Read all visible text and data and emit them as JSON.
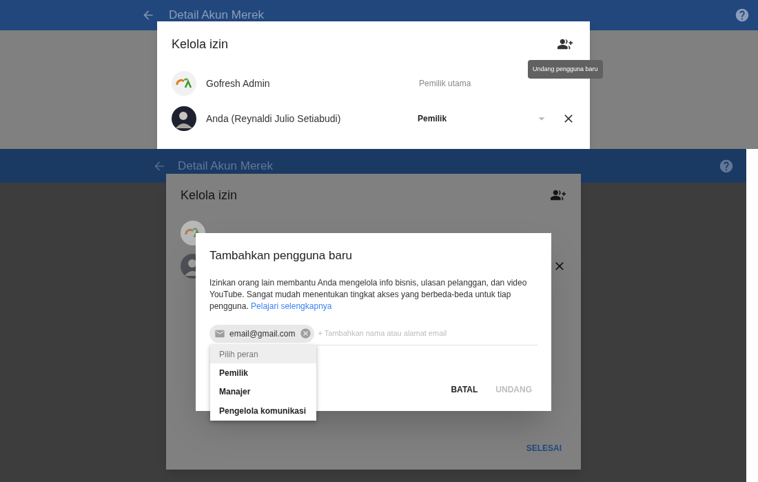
{
  "top_screen": {
    "app_bar": {
      "title": "Detail Akun Merek"
    },
    "dialog": {
      "title": "Kelola izin",
      "members": [
        {
          "kind": "fixed",
          "name": "Gofresh Admin",
          "role": "Pemilik utama"
        },
        {
          "kind": "editable",
          "name": "Anda (Reynaldi Julio Setiabudi)",
          "role": "Pemilik"
        }
      ]
    },
    "tooltip": "Undang pengguna baru"
  },
  "bottom_screen": {
    "app_bar": {
      "title": "Detail Akun Merek"
    },
    "dialog": {
      "title": "Kelola izin",
      "members": [
        {
          "kind": "fixed"
        },
        {
          "kind": "editable"
        }
      ],
      "done_button": "SELESAI"
    },
    "invite_dialog": {
      "title": "Tambahkan pengguna baru",
      "description": "Izinkan orang lain membantu Anda mengelola info bisnis, ulasan pelanggan, dan video YouTube. Sangat mudah menentukan tingkat akses yang berbeda-beda untuk tiap pengguna.",
      "link": "Pelajari selengkapnya",
      "chips": [
        {
          "text": "email@gmail.com"
        }
      ],
      "input": {
        "placeholder": "+ Tambahkan nama atau alamat email"
      },
      "role_menu": [
        {
          "label": "Pilih peran",
          "selected": true
        },
        {
          "label": "Pemilik",
          "selected": false
        },
        {
          "label": "Manajer",
          "selected": false
        },
        {
          "label": "Pengelola komunikasi",
          "selected": false
        }
      ],
      "buttons": [
        {
          "label": "BATAL",
          "disabled": false
        },
        {
          "label": "UNDANG",
          "disabled": true
        }
      ]
    }
  }
}
